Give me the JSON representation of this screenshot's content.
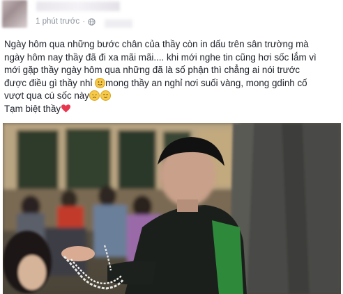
{
  "post": {
    "timestamp": "1 phút trước",
    "separator": "·",
    "privacy_icon": "globe-icon",
    "line1": "Ngày hôm qua những bước chân của thầy còn in dấu trên sân trường mà",
    "line2": "ngày hôm nay thầy đã đi xa mãi mãi.... khi mới nghe tin cũng hơi sốc lắm vì",
    "line3": "mới gặp thầy ngày hôm qua những đã là số phận thì chẳng ai nói trước",
    "line4_before_emoji": "được điều gì thầy nhỉ",
    "line4_after_emoji": "mong thầy an nghỉ nơi suối vàng, mong gdinh cố",
    "line5": "vượt qua cú sốc này",
    "line6": "Tạm biệt thầy",
    "emojis": [
      "smile-emoji",
      "sad-emoji",
      "relieved-emoji",
      "heart-icon"
    ],
    "colors": {
      "text": "#1d2129",
      "meta": "#8d949e",
      "heart": "#e8384f"
    }
  }
}
